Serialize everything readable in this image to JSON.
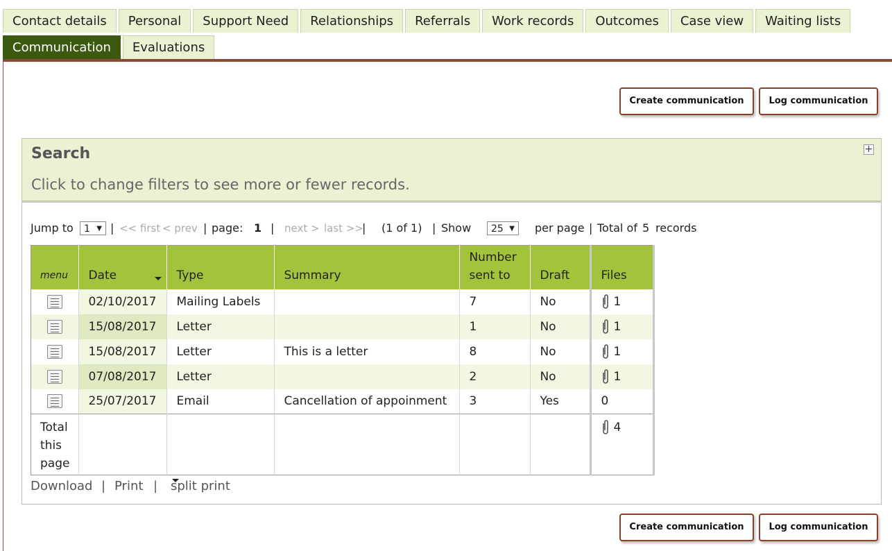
{
  "tabs_row1": [
    "Contact details",
    "Personal",
    "Support Need",
    "Relationships",
    "Referrals",
    "Work records",
    "Outcomes",
    "Case view",
    "Waiting lists"
  ],
  "tabs_row2": [
    "Communication",
    "Evaluations"
  ],
  "active_tab": "Communication",
  "actions": {
    "create_label": "Create communication",
    "log_label": "Log communication"
  },
  "search": {
    "title": "Search",
    "subtitle": "Click to change filters to see more or fewer records.",
    "expand_icon": "plus-icon"
  },
  "pager": {
    "jump_to_label": "Jump to",
    "jump_value": "1",
    "sep": "|",
    "first": "<< first",
    "prev": "< prev",
    "page_label": "page:",
    "page_value": "1",
    "next": "next >",
    "last": "last >>",
    "range": "(1 of 1)",
    "show_label": "Show",
    "show_value": "25",
    "per_page": "per page",
    "total_prefix": "Total of",
    "total_value": "5",
    "total_suffix": "records"
  },
  "table": {
    "headers": {
      "menu": "menu",
      "date": "Date",
      "type": "Type",
      "summary": "Summary",
      "number_line1": "Number",
      "number_line2": "sent to",
      "draft": "Draft",
      "files": "Files"
    },
    "rows": [
      {
        "date": "02/10/2017",
        "type": "Mailing Labels",
        "summary": "",
        "number": "7",
        "draft": "No",
        "files": "1",
        "has_clip": true
      },
      {
        "date": "15/08/2017",
        "type": "Letter",
        "summary": "",
        "number": "1",
        "draft": "No",
        "files": "1",
        "has_clip": true
      },
      {
        "date": "15/08/2017",
        "type": "Letter",
        "summary": "This is a letter",
        "number": "8",
        "draft": "No",
        "files": "1",
        "has_clip": true
      },
      {
        "date": "07/08/2017",
        "type": "Letter",
        "summary": "",
        "number": "2",
        "draft": "No",
        "files": "1",
        "has_clip": true
      },
      {
        "date": "25/07/2017",
        "type": "Email",
        "summary": "Cancellation of appoinment",
        "number": "3",
        "draft": "Yes",
        "files": "0",
        "has_clip": false
      }
    ],
    "total": {
      "line1": "Total",
      "line2": "this",
      "line3": "page",
      "files": "4"
    }
  },
  "footer": {
    "download": "Download",
    "sep": "|",
    "print": "Print",
    "split_print": "split print"
  },
  "colors": {
    "active_tab": "#3c5a0f",
    "tab_bg": "#e9f2d1",
    "header_green": "#a3c33d",
    "accent_brown": "#8b4a33"
  }
}
